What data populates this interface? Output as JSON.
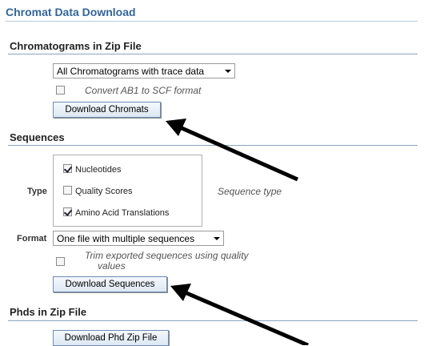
{
  "page_title": "Chromat Data Download",
  "chromat_section": {
    "title": "Chromatograms in Zip File",
    "dropdown_value": "All Chromatograms with trace data",
    "convert_label": "Convert AB1 to SCF format",
    "convert_checked": false,
    "button_label": "Download Chromats"
  },
  "sequences_section": {
    "title": "Sequences",
    "type_label": "Type",
    "type_options": [
      {
        "label": "Nucleotides",
        "checked": true
      },
      {
        "label": "Quality Scores",
        "checked": false
      },
      {
        "label": "Amino Acid Translations",
        "checked": true
      }
    ],
    "sequence_type_note": "Sequence type",
    "format_label": "Format",
    "format_value": "One file with multiple sequences",
    "trim_line1": "Trim exported sequences using quality",
    "trim_line2": "values",
    "trim_checked": false,
    "button_label": "Download Sequences"
  },
  "phd_section": {
    "title": "Phds in Zip File",
    "button_label": "Download Phd Zip File"
  }
}
